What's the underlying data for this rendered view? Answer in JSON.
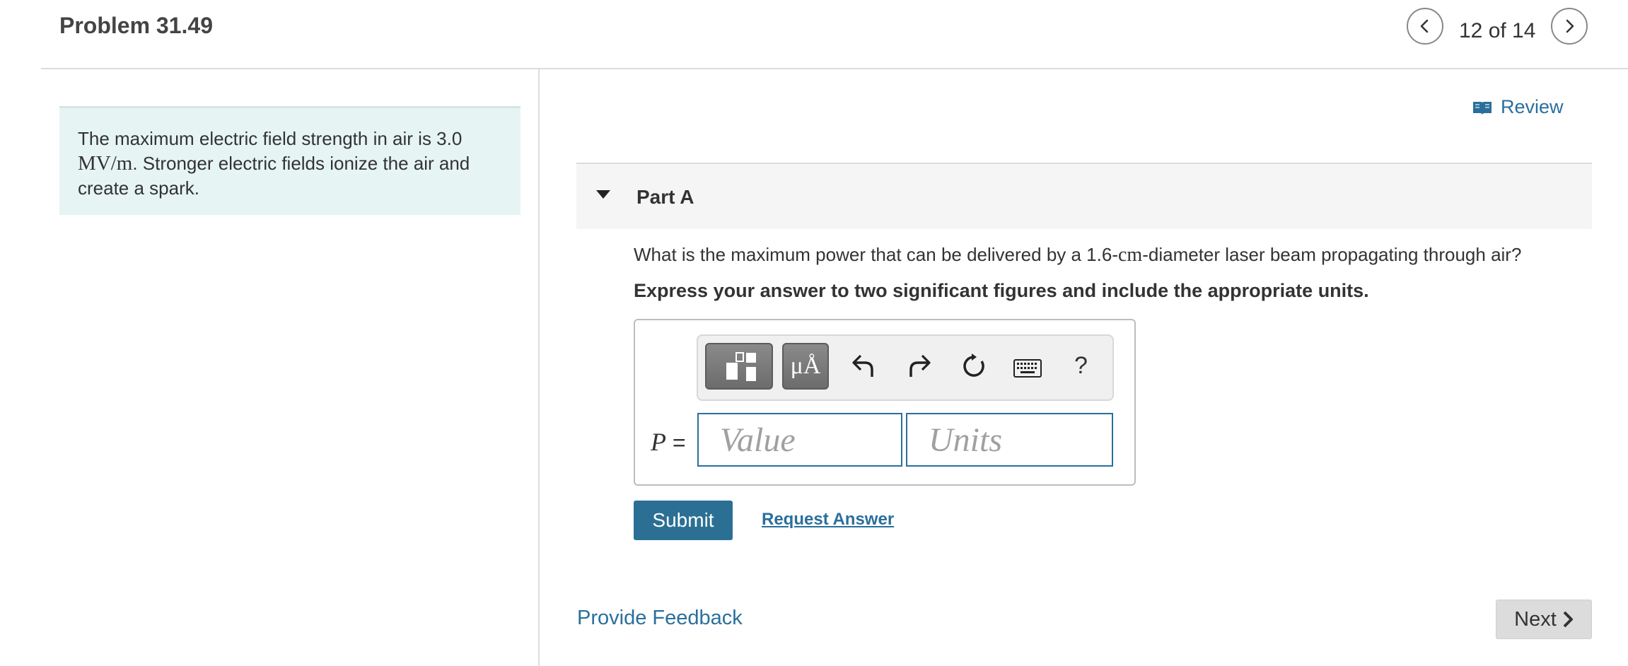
{
  "header": {
    "title": "Problem 31.49",
    "counter": "12 of 14",
    "prev_icon": "chevron-left-icon",
    "next_icon": "chevron-right-icon"
  },
  "intro": {
    "text_before": "The maximum electric field strength in air is 3.0",
    "unit": "MV/m",
    "text_after": ". Stronger electric fields ionize the air and create a spark."
  },
  "review": {
    "label": "Review",
    "icon": "book-icon"
  },
  "part": {
    "title": "Part A",
    "question_before": "What is the maximum power that can be delivered by a 1.6-",
    "question_unit": "cm",
    "question_after": "-diameter laser beam propagating through air?",
    "instruction": "Express your answer to two significant figures and include the appropriate units."
  },
  "toolbar": {
    "templates_icon": "templates-icon",
    "units_label": "μÅ",
    "undo_icon": "undo-icon",
    "redo_icon": "redo-icon",
    "reset_icon": "reset-icon",
    "keyboard_icon": "keyboard-icon",
    "help_label": "?"
  },
  "answer": {
    "variable": "P",
    "equals": "=",
    "value_placeholder": "Value",
    "units_placeholder": "Units",
    "value": "",
    "units": ""
  },
  "actions": {
    "submit_label": "Submit",
    "request_answer_label": "Request Answer",
    "feedback_label": "Provide Feedback",
    "next_label": "Next"
  },
  "colors": {
    "accent": "#2a6f9c",
    "submit_bg": "#2b7094",
    "intro_bg": "#e6f4f4",
    "part_header_bg": "#f5f5f5"
  }
}
